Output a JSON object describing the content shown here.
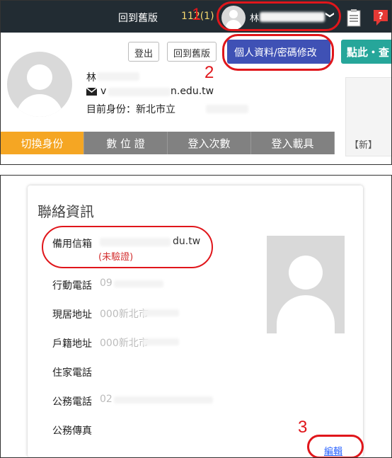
{
  "navbar": {
    "back_old_label": "回到舊版",
    "count_label": "112(1)",
    "user_name_prefix": "林",
    "chevron": "❯",
    "clipboard_icon": "clipboard-icon",
    "help_icon": "help-icon"
  },
  "dropdown": {
    "logout_label": "登出",
    "old_version_label": "回到舊版",
    "edit_profile_label": "個人資料/密碼修改",
    "click_here_label": "點此・查",
    "name_prefix": "林",
    "email_prefix": "v",
    "email_suffix": "n.edu.tw",
    "identity_label": "目前身份：新北市立",
    "tabs": [
      "切換身份",
      "數 位 證",
      "登入次數",
      "登入載具"
    ],
    "side_text": "【新】"
  },
  "contact": {
    "title": "聯絡資訊",
    "backup_email_label": "備用信箱",
    "backup_email_value_suffix": "du.tw",
    "unverified_label": "(未驗證)",
    "mobile_label": "行動電話",
    "mobile_value": "09",
    "residence_label": "現居地址",
    "residence_value": "000新北市",
    "household_label": "戶籍地址",
    "household_value": "000新北市",
    "home_phone_label": "住家電話",
    "office_phone_label": "公務電話",
    "office_phone_value": "02",
    "office_fax_label": "公務傳真",
    "edit_label": "編輯"
  },
  "annotations": {
    "step1": "1",
    "step2": "2",
    "step3": "3",
    "color": "#e0161b"
  }
}
